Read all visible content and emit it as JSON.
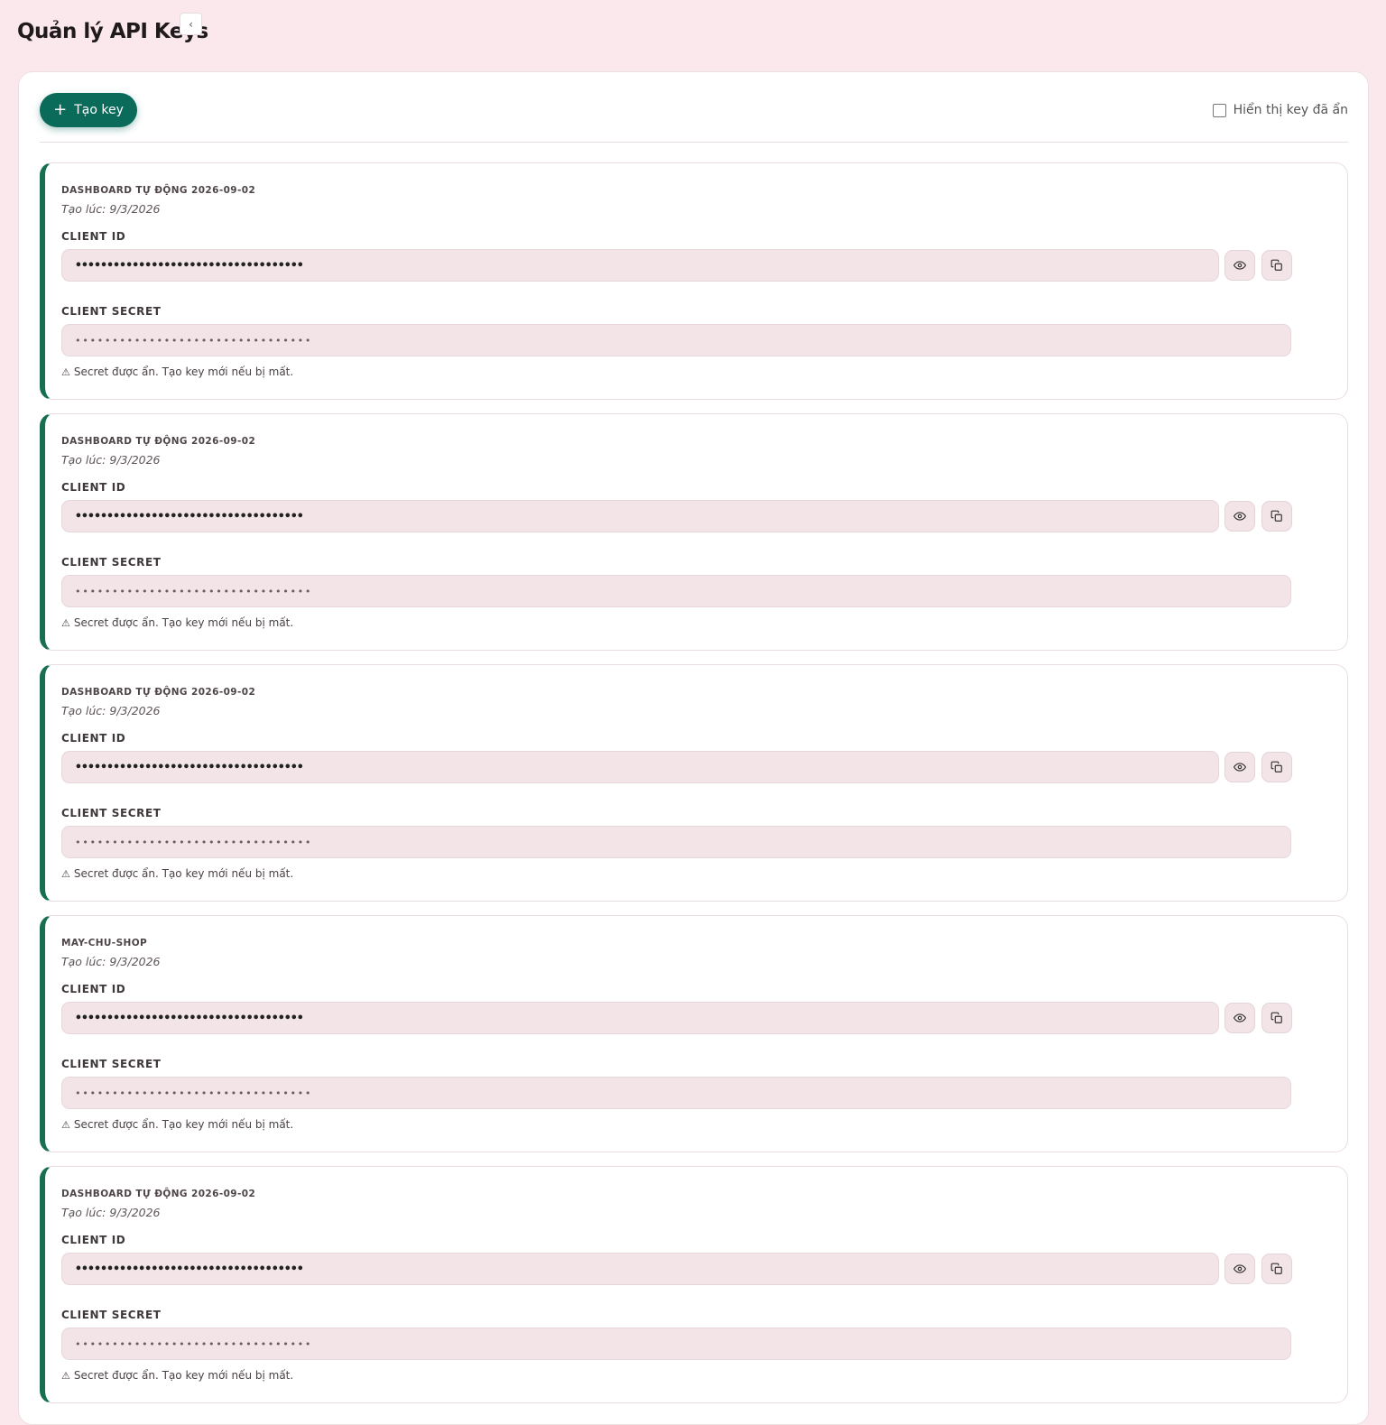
{
  "header": {
    "title": "Quản lý API Keys",
    "collapse_glyph": "‹"
  },
  "toolbar": {
    "create_plus": "+",
    "create_label": "Tạo key",
    "show_hidden_label": "Hiển thị key đã ẩn",
    "show_hidden_checked": false
  },
  "labels": {
    "client_id": "CLIENT ID",
    "client_secret": "CLIENT SECRET",
    "warning_glyph": "⚠",
    "warning_text": "Secret được ẩn. Tạo key mới nếu bị mất."
  },
  "icons": {
    "eye": "eye-icon",
    "copy": "copy-icon"
  },
  "colors": {
    "accent": "#0b6b5b",
    "card_border_left": "#16704f",
    "page_background": "#fbe8ec",
    "field_background": "#f3e4e8"
  },
  "keys": [
    {
      "name": "DASHBOARD TỰ ĐỘNG 2026-09-02",
      "created": "Tạo lúc: 9/3/2026",
      "client_id_masked": "••••••••••••••••••••••••••••••••••••",
      "client_secret_masked": "••••••••••••••••••••••••••••••••"
    },
    {
      "name": "DASHBOARD TỰ ĐỘNG 2026-09-02",
      "created": "Tạo lúc: 9/3/2026",
      "client_id_masked": "••••••••••••••••••••••••••••••••••••",
      "client_secret_masked": "••••••••••••••••••••••••••••••••"
    },
    {
      "name": "DASHBOARD TỰ ĐỘNG 2026-09-02",
      "created": "Tạo lúc: 9/3/2026",
      "client_id_masked": "••••••••••••••••••••••••••••••••••••",
      "client_secret_masked": "••••••••••••••••••••••••••••••••"
    },
    {
      "name": "MAY-CHU-SHOP",
      "created": "Tạo lúc: 9/3/2026",
      "client_id_masked": "••••••••••••••••••••••••••••••••••••",
      "client_secret_masked": "••••••••••••••••••••••••••••••••"
    },
    {
      "name": "DASHBOARD TỰ ĐỘNG 2026-09-02",
      "created": "Tạo lúc: 9/3/2026",
      "client_id_masked": "••••••••••••••••••••••••••••••••••••",
      "client_secret_masked": "••••••••••••••••••••••••••••••••"
    }
  ]
}
